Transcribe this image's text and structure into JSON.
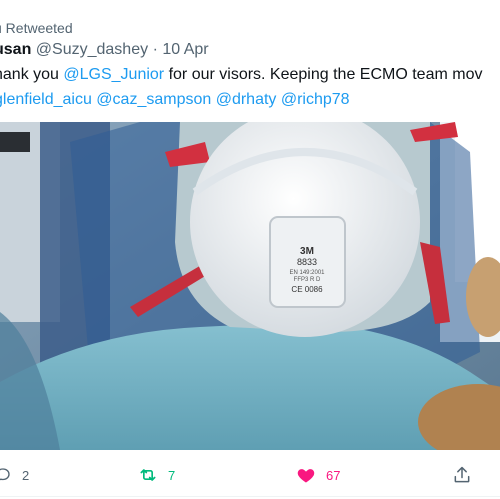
{
  "tweet": {
    "retweeted_label": "u Retweeted",
    "author_name": "usan",
    "author_handle": "@Suzy_dashey",
    "separator": "·",
    "date": "10 Apr",
    "text_prefix": "hank you ",
    "mention_junior": "@LGS_Junior",
    "text_suffix": " for our visors. Keeping the ECMO team mov",
    "mentions_line": "glenfield_aicu @caz_sampson @drhaty @richp78"
  },
  "media": {
    "mask_brand": "3M",
    "mask_model": "8833",
    "mask_line1": "EN 149:2001",
    "mask_line2": "FFP3 R D",
    "mask_ce": "CE 0086"
  },
  "actions": {
    "reply_count": "2",
    "retweet_count": "7",
    "like_count": "67"
  },
  "colors": {
    "link": "#1d9bf0",
    "retweet_active": "#00ba7c",
    "like_active": "#f91880",
    "muted": "#536471"
  },
  "icons": [
    "reply-icon",
    "retweet-icon",
    "heart-icon",
    "share-icon"
  ]
}
